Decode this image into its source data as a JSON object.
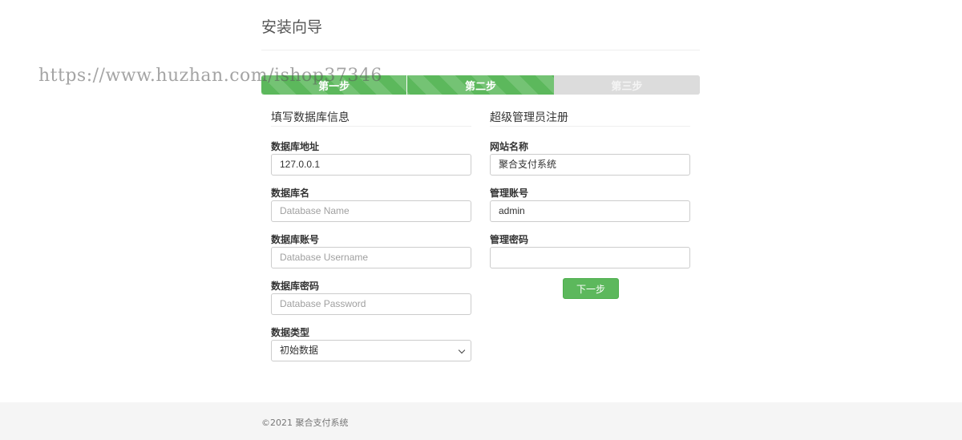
{
  "page": {
    "title": "安装向导"
  },
  "watermark": "https://www.huzhan.com/ishop37346",
  "progress": {
    "steps": [
      "第一步",
      "第二步",
      "第三步"
    ],
    "completed": 2,
    "accent": "#5cb85c"
  },
  "database": {
    "section_title": "填写数据库信息",
    "host_label": "数据库地址",
    "host_value": "127.0.0.1",
    "name_label": "数据库名",
    "name_placeholder": "Database Name",
    "user_label": "数据库账号",
    "user_placeholder": "Database Username",
    "password_label": "数据库密码",
    "password_placeholder": "Database Password",
    "type_label": "数据类型",
    "type_value": "初始数据"
  },
  "admin": {
    "section_title": "超级管理员注册",
    "site_name_label": "网站名称",
    "site_name_value": "聚合支付系统",
    "account_label": "管理账号",
    "account_value": "admin",
    "password_label": "管理密码",
    "password_value": "",
    "next_label": "下一步"
  },
  "footer": {
    "text": "©2021 聚合支付系统"
  }
}
